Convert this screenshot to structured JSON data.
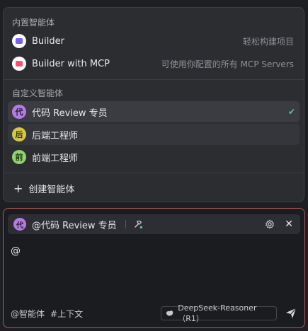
{
  "menu": {
    "builtin_title": "内置智能体",
    "builtin": [
      {
        "label": "Builder",
        "desc": "轻松构建项目",
        "icon": "builder-app-icon",
        "color": "#7b5cff"
      },
      {
        "label": "Builder with MCP",
        "desc": "可使用你配置的所有 MCP Servers",
        "icon": "builder-mcp-app-icon",
        "color": "#ff4d6d"
      }
    ],
    "custom_title": "自定义智能体",
    "custom": [
      {
        "label": "代码 Review 专员",
        "avatar": "代",
        "color": "#b57be3",
        "selected": true
      },
      {
        "label": "后端工程师",
        "avatar": "后",
        "color": "#d4c84a",
        "selected": false
      },
      {
        "label": "前端工程师",
        "avatar": "前",
        "color": "#8fd46a",
        "selected": false
      }
    ],
    "create_label": "创建智能体"
  },
  "composer": {
    "agent_avatar": "代",
    "agent_name": "@代码 Review 专员",
    "typed_text": "@",
    "mention_agent": "@智能体",
    "mention_context": "#上下文",
    "model": "DeepSeek-Reasoner（R1）"
  }
}
